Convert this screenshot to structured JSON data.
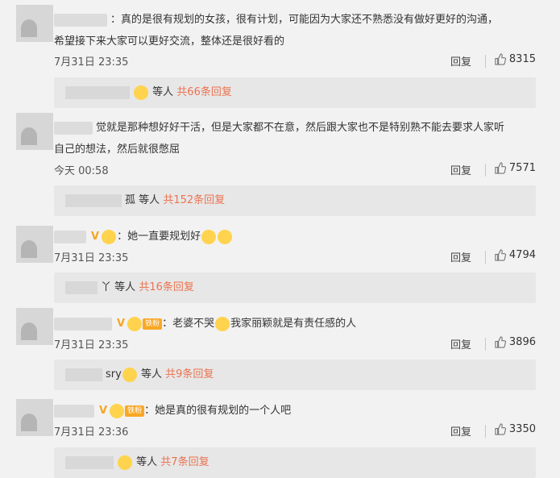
{
  "comments": [
    {
      "line1": "：真的是很有规划的女孩，很有计划，可能因为大家还不熟悉没有做好更好的沟通，",
      "line2": "希望接下来大家可以更好交流，整体还是很好看的",
      "time": "7月31日 23:35",
      "reply": "回复",
      "likes": "8315",
      "sub_people": "等人",
      "sub_count": "共66条回复"
    },
    {
      "line1": "觉就是那种想好好干活，但是大家都不在意，然后跟大家也不是特别熟不能去要求人家听",
      "line2": "自己的想法，然后就很憋屈",
      "time": "今天 00:58",
      "reply": "回复",
      "likes": "7571",
      "sub_tail": "孤",
      "sub_people": "等人",
      "sub_count": "共152条回复"
    },
    {
      "line1": "：她一直要规划好",
      "time": "7月31日 23:35",
      "reply": "回复",
      "likes": "4794",
      "sub_tail": "丫",
      "sub_people": "等人",
      "sub_count": "共16条回复"
    },
    {
      "line1": "：老婆不哭",
      "line1b": "我家丽颖就是有责任感的人",
      "fan": "铁粉",
      "time": "7月31日 23:35",
      "reply": "回复",
      "likes": "3896",
      "sub_tail": "sry",
      "sub_people": "等人",
      "sub_count": "共9条回复"
    },
    {
      "line1": "：她是真的很有规划的一个人吧",
      "fan": "铁粉",
      "time": "7月31日 23:36",
      "reply": "回复",
      "likes": "3350",
      "sub_people": "等人",
      "sub_count": "共7条回复"
    }
  ]
}
